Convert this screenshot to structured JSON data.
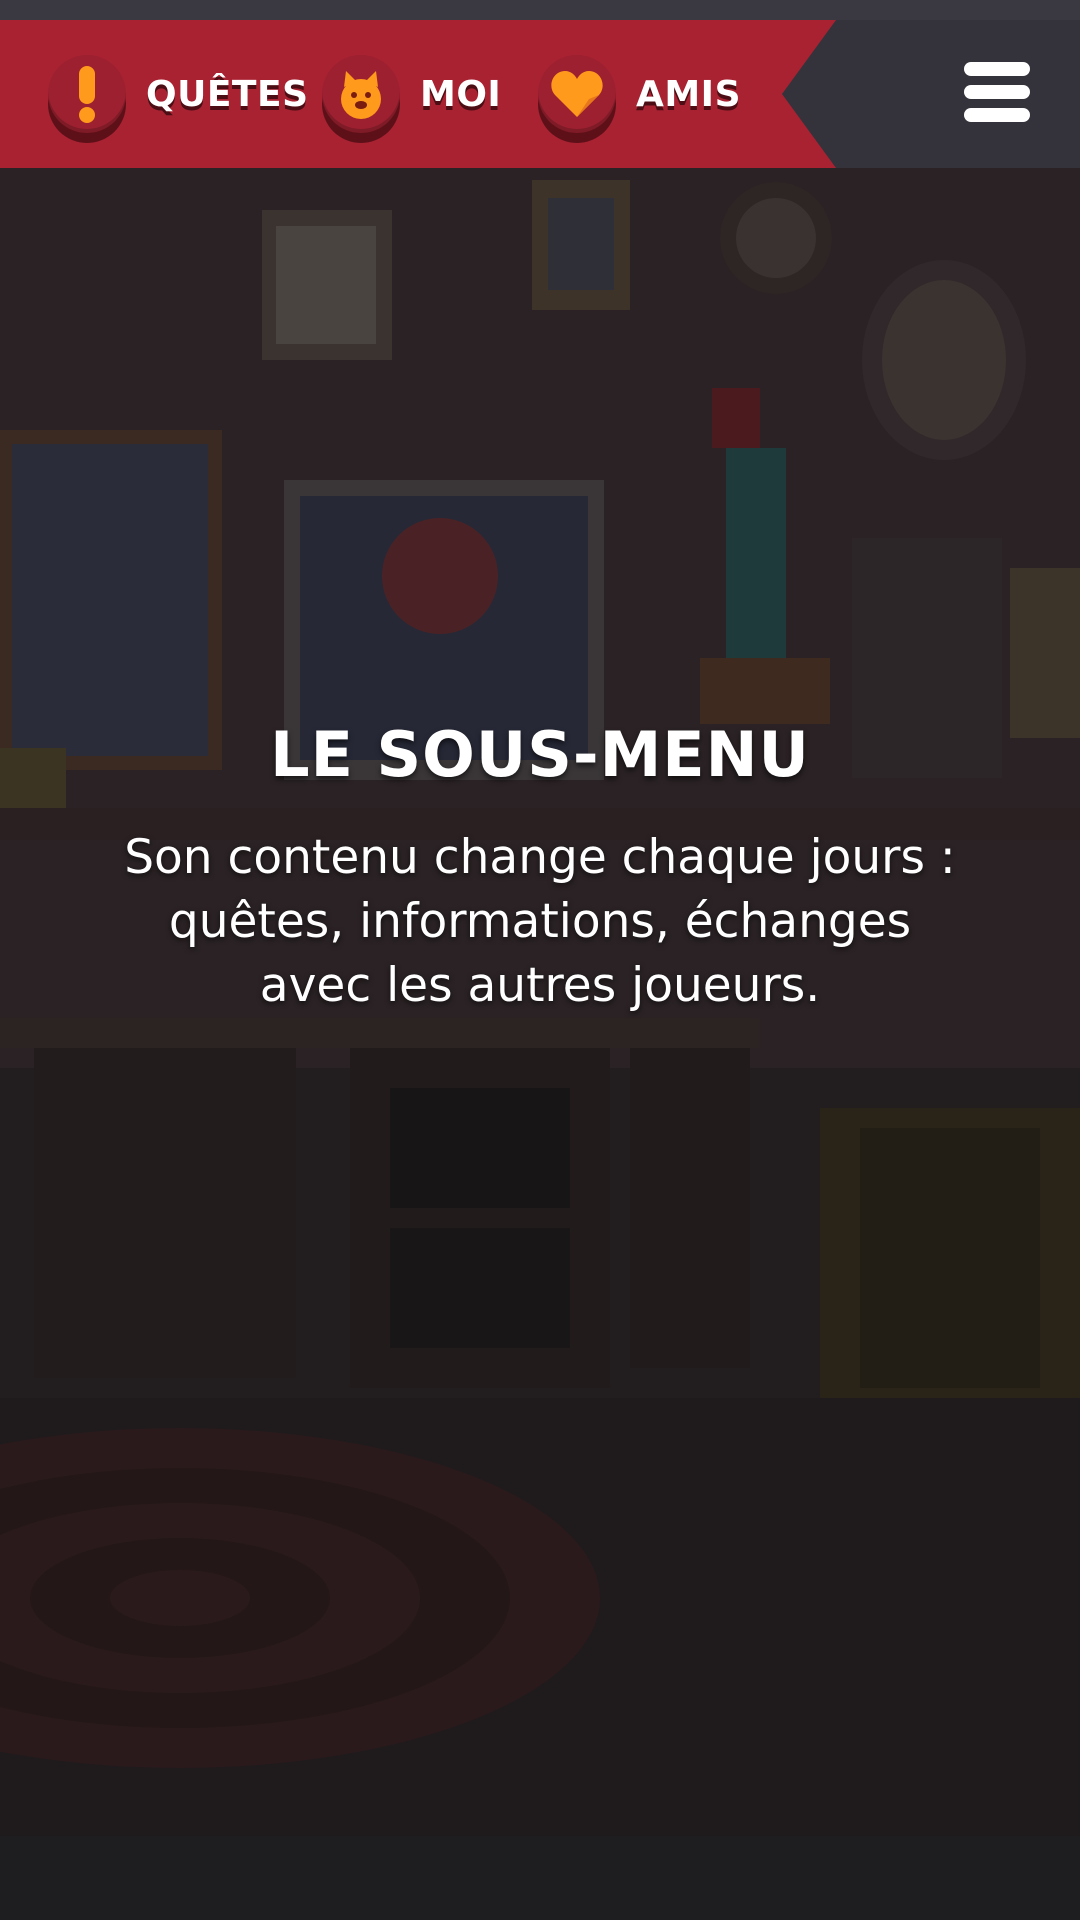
{
  "tabs": [
    {
      "label": "QUÊTES",
      "icon": "exclamation-icon"
    },
    {
      "label": "MOI",
      "icon": "creature-face-icon"
    },
    {
      "label": "AMIS",
      "icon": "heart-icon"
    }
  ],
  "menu": {
    "icon": "hamburger-menu-icon"
  },
  "overlay": {
    "title": "LE SOUS-MENU",
    "description": "Son contenu change chaque jours : quêtes, informations, échanges avec les autres joueurs."
  },
  "colors": {
    "ribbon": "#a82232",
    "top_bar": "#34333b",
    "badge": "#9c2030",
    "icon_orange": "#ff9a1c",
    "text": "#ffffff"
  }
}
